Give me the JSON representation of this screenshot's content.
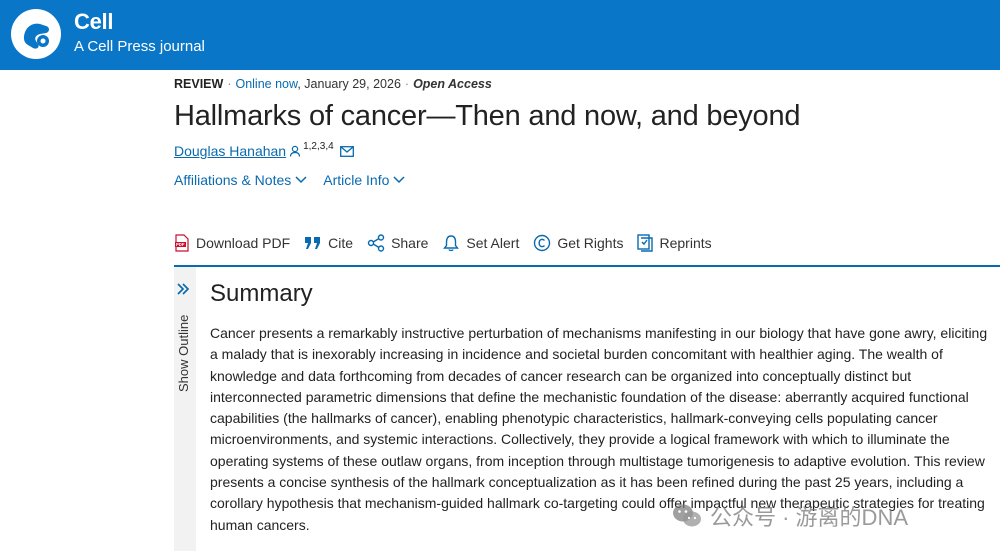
{
  "header": {
    "brand": "Cell",
    "tagline": "A Cell Press journal",
    "bg_color": "#0a76c7"
  },
  "meta": {
    "type": "REVIEW",
    "online": "Online now",
    "date": ", January 29, 2026",
    "access": "Open Access"
  },
  "article": {
    "title": "Hallmarks of cancer—Then and now, and beyond",
    "author": "Douglas Hanahan",
    "author_affiliations": "1,2,3,4"
  },
  "info_links": {
    "affiliations": "Affiliations & Notes",
    "article_info": "Article Info"
  },
  "toolbar": {
    "download_pdf": "Download PDF",
    "cite": "Cite",
    "share": "Share",
    "set_alert": "Set Alert",
    "get_rights": "Get Rights",
    "reprints": "Reprints"
  },
  "outline": {
    "label": "Show Outline"
  },
  "summary": {
    "title": "Summary",
    "text": "Cancer presents a remarkably instructive perturbation of mechanisms manifesting in our biology that have gone awry, eliciting a malady that is inexorably increasing in incidence and societal burden concomitant with healthier aging. The wealth of knowledge and data forthcoming from decades of cancer research can be organized into conceptually distinct but interconnected parametric dimensions that define the mechanistic foundation of the disease: aberrantly acquired functional capabilities (the hallmarks of cancer), enabling phenotypic characteristics, hallmark-conveying cells populating cancer microenvironments, and systemic interactions. Collectively, they provide a logical framework with which to illuminate the operating systems of these outlaw organs, from inception through multistage tumorigenesis to adaptive evolution. This review presents a concise synthesis of the hallmark conceptualization as it has been refined during the past 25 years, including a corollary hypothesis that mechanism-guided hallmark co-targeting could offer impactful new therapeutic strategies for treating human cancers."
  },
  "watermark": {
    "text": "公众号 · 游离的DNA"
  }
}
